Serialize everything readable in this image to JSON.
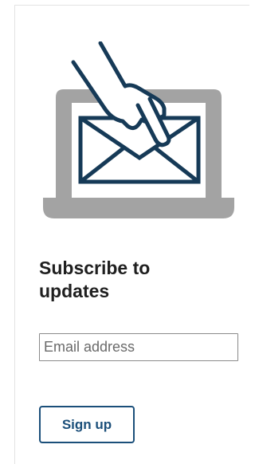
{
  "subscribe": {
    "title": "Subscribe to updates",
    "email_placeholder": "Email address",
    "email_value": "",
    "button_label": "Sign up"
  },
  "illustration": {
    "icons": [
      "laptop-icon",
      "envelope-icon",
      "pointing-hand-icon"
    ],
    "colors": {
      "laptop": "#a3a3a3",
      "line": "#163a57",
      "screen": "#ffffff"
    }
  },
  "colors": {
    "accent": "#1b4f7a",
    "text": "#1f1f1f",
    "input_border": "#8a8a8a"
  }
}
